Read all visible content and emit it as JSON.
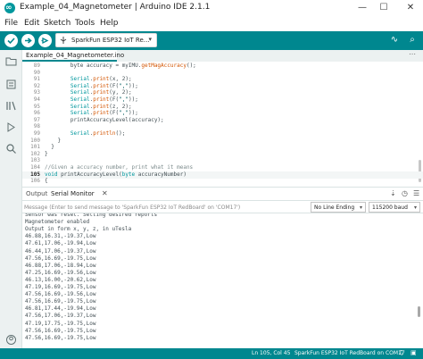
{
  "window": {
    "title": "Example_04_Magnetometer | Arduino IDE 2.1.1",
    "app_icon_glyph": "∞",
    "minimize_glyph": "—",
    "maximize_glyph": "☐",
    "close_glyph": "✕"
  },
  "menu": [
    "File",
    "Edit",
    "Sketch",
    "Tools",
    "Help"
  ],
  "toolbar": {
    "board": "SparkFun ESP32 IoT Re…",
    "board_caret": "▾",
    "serial_plotter_glyph": "∿",
    "serial_monitor_glyph": "⌕",
    "accent": "#00878f"
  },
  "editor": {
    "tab_name": "Example_04_Magnetometer.ino",
    "more_glyph": "⋯",
    "lines": [
      {
        "n": "89",
        "parts": [
          {
            "t": "        byte accuracy = myIMU.",
            "c": "c-pl"
          },
          {
            "t": "getMagAccuracy",
            "c": "c-fn"
          },
          {
            "t": "();",
            "c": "c-pl"
          }
        ]
      },
      {
        "n": "90",
        "parts": [
          {
            "t": "",
            "c": "c-pl"
          }
        ]
      },
      {
        "n": "91",
        "parts": [
          {
            "t": "        ",
            "c": "c-pl"
          },
          {
            "t": "Serial",
            "c": "c-kw"
          },
          {
            "t": ".",
            "c": "c-pl"
          },
          {
            "t": "print",
            "c": "c-fn"
          },
          {
            "t": "(x, 2);",
            "c": "c-pl"
          }
        ]
      },
      {
        "n": "92",
        "parts": [
          {
            "t": "        ",
            "c": "c-pl"
          },
          {
            "t": "Serial",
            "c": "c-kw"
          },
          {
            "t": ".",
            "c": "c-pl"
          },
          {
            "t": "print",
            "c": "c-fn"
          },
          {
            "t": "(F(",
            "c": "c-pl"
          },
          {
            "t": "\",\"",
            "c": "c-str"
          },
          {
            "t": "));",
            "c": "c-pl"
          }
        ]
      },
      {
        "n": "93",
        "parts": [
          {
            "t": "        ",
            "c": "c-pl"
          },
          {
            "t": "Serial",
            "c": "c-kw"
          },
          {
            "t": ".",
            "c": "c-pl"
          },
          {
            "t": "print",
            "c": "c-fn"
          },
          {
            "t": "(y, 2);",
            "c": "c-pl"
          }
        ]
      },
      {
        "n": "94",
        "parts": [
          {
            "t": "        ",
            "c": "c-pl"
          },
          {
            "t": "Serial",
            "c": "c-kw"
          },
          {
            "t": ".",
            "c": "c-pl"
          },
          {
            "t": "print",
            "c": "c-fn"
          },
          {
            "t": "(F(",
            "c": "c-pl"
          },
          {
            "t": "\",\"",
            "c": "c-str"
          },
          {
            "t": "));",
            "c": "c-pl"
          }
        ]
      },
      {
        "n": "95",
        "parts": [
          {
            "t": "        ",
            "c": "c-pl"
          },
          {
            "t": "Serial",
            "c": "c-kw"
          },
          {
            "t": ".",
            "c": "c-pl"
          },
          {
            "t": "print",
            "c": "c-fn"
          },
          {
            "t": "(z, 2);",
            "c": "c-pl"
          }
        ]
      },
      {
        "n": "96",
        "parts": [
          {
            "t": "        ",
            "c": "c-pl"
          },
          {
            "t": "Serial",
            "c": "c-kw"
          },
          {
            "t": ".",
            "c": "c-pl"
          },
          {
            "t": "print",
            "c": "c-fn"
          },
          {
            "t": "(F(",
            "c": "c-pl"
          },
          {
            "t": "\",\"",
            "c": "c-str"
          },
          {
            "t": "));",
            "c": "c-pl"
          }
        ]
      },
      {
        "n": "97",
        "parts": [
          {
            "t": "        printAccuracyLevel(accuracy);",
            "c": "c-pl"
          }
        ]
      },
      {
        "n": "98",
        "parts": [
          {
            "t": "",
            "c": "c-pl"
          }
        ]
      },
      {
        "n": "99",
        "parts": [
          {
            "t": "        ",
            "c": "c-pl"
          },
          {
            "t": "Serial",
            "c": "c-kw"
          },
          {
            "t": ".",
            "c": "c-pl"
          },
          {
            "t": "println",
            "c": "c-fn"
          },
          {
            "t": "();",
            "c": "c-pl"
          }
        ]
      },
      {
        "n": "100",
        "parts": [
          {
            "t": "    }",
            "c": "c-pl"
          }
        ]
      },
      {
        "n": "101",
        "parts": [
          {
            "t": "  }",
            "c": "c-pl"
          }
        ]
      },
      {
        "n": "102",
        "parts": [
          {
            "t": "}",
            "c": "c-pl"
          }
        ]
      },
      {
        "n": "103",
        "parts": [
          {
            "t": "",
            "c": "c-pl"
          }
        ]
      },
      {
        "n": "104",
        "parts": [
          {
            "t": "//Given a accuracy number, print what it means",
            "c": "c-cm"
          }
        ]
      },
      {
        "n": "105",
        "parts": [
          {
            "t": "void",
            "c": "c-kw"
          },
          {
            "t": " printAccuracyLevel(",
            "c": "c-pl"
          },
          {
            "t": "byte",
            "c": "c-kw"
          },
          {
            "t": " accuracyNumber)",
            "c": "c-pl"
          }
        ],
        "active": true
      },
      {
        "n": "106",
        "parts": [
          {
            "t": "{",
            "c": "c-pl"
          }
        ]
      }
    ]
  },
  "panel": {
    "tabs": [
      "Output",
      "Serial Monitor"
    ],
    "close_glyph": "✕",
    "autoscroll_glyph": "⇣",
    "timestamp_glyph": "◷",
    "clear_glyph": "☰",
    "input_placeholder": "Message (Enter to send message to 'SparkFun ESP32 IoT RedBoard' on 'COM17')",
    "line_ending": "No Line Ending",
    "baud": "115200 baud",
    "caret": "▾",
    "output_lines": [
      "Sensor was reset. Setting desired reports",
      "Magnetometer enabled",
      "Output in form x, y, z, in uTesla",
      "46.88,16.31,-19.37,Low",
      "47.61,17.06,-19.94,Low",
      "46.44,17.06,-19.37,Low",
      "47.56,16.69,-19.75,Low",
      "46.88,17.06,-18.94,Low",
      "47.25,16.69,-19.56,Low",
      "46.13,16.00,-20.62,Low",
      "47.19,16.69,-19.75,Low",
      "47.56,16.69,-19.56,Low",
      "47.56,16.69,-19.75,Low",
      "46.81,17.44,-19.94,Low",
      "47.56,17.06,-19.37,Low",
      "47.19,17.75,-19.75,Low",
      "47.56,16.69,-19.75,Low",
      "47.56,16.69,-19.75,Low"
    ]
  },
  "status": {
    "cursor": "Ln 105, Col 45",
    "board_port": "SparkFun ESP32 IoT RedBoard on COM17",
    "notifications_glyph": "♫",
    "layout_glyph": "▣"
  }
}
